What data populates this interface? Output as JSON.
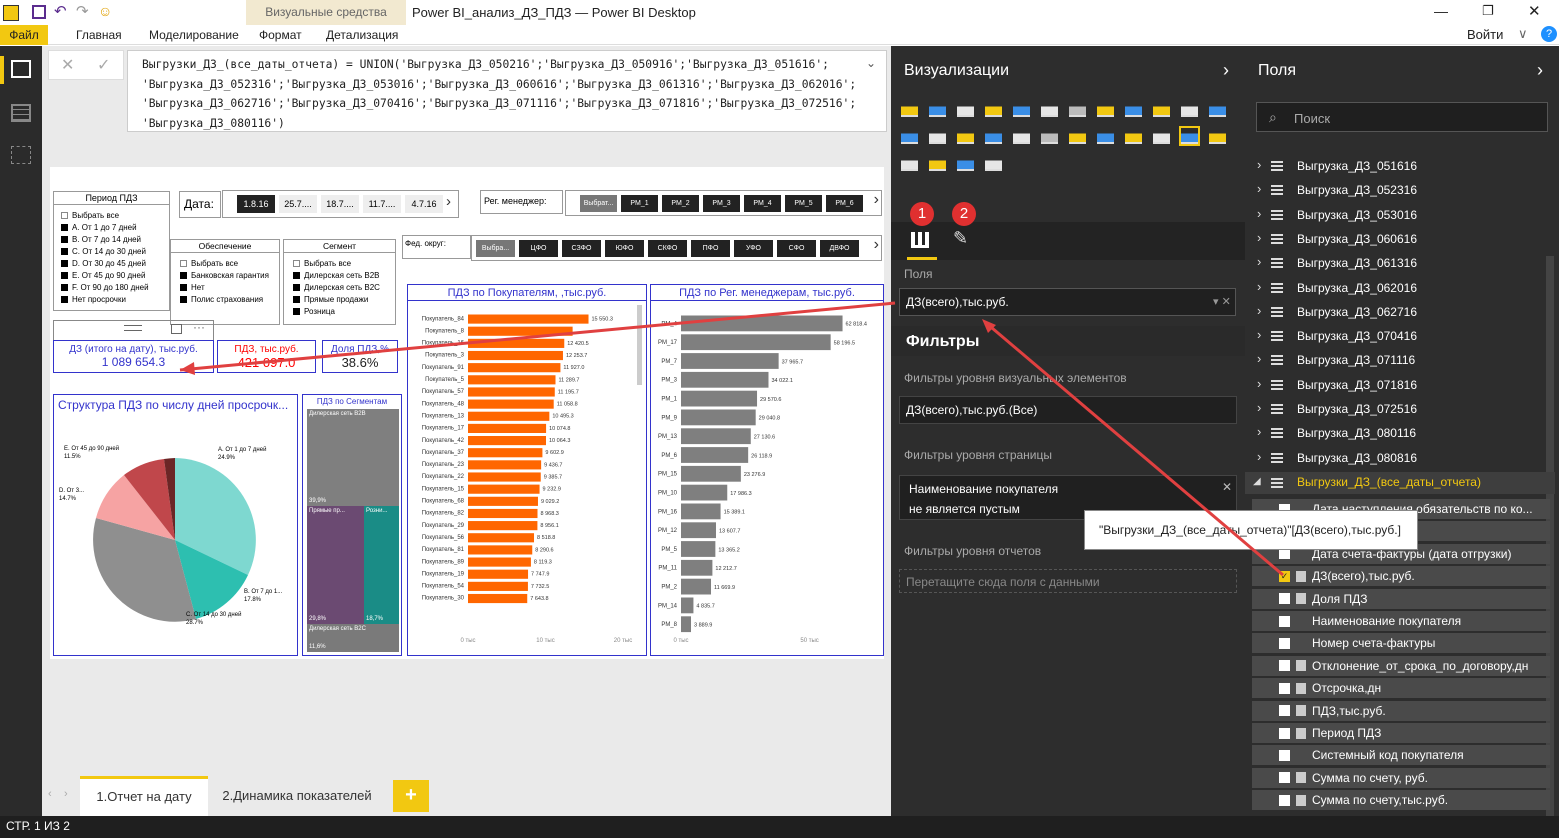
{
  "window": {
    "title": "Power BI_анализ_ДЗ_ПДЗ — Power BI Desktop",
    "context_tab": "Визуальные средства",
    "signin": "Войти",
    "ribbon_tabs": [
      "Файл",
      "Главная",
      "Моделирование",
      "Формат",
      "Детализация"
    ]
  },
  "formula": {
    "text": "Выгрузки_ДЗ_(все_даты_отчета) = UNION('Выгрузка_ДЗ_050216';'Выгрузка_ДЗ_050916';'Выгрузка_ДЗ_051616';\n'Выгрузка_ДЗ_052316';'Выгрузка_ДЗ_053016';'Выгрузка_ДЗ_060616';'Выгрузка_ДЗ_061316';'Выгрузка_ДЗ_062016';\n'Выгрузка_ДЗ_062716';'Выгрузка_ДЗ_070416';'Выгрузка_ДЗ_071116';'Выгрузка_ДЗ_071816';'Выгрузка_ДЗ_072516';\n'Выгрузка_ДЗ_080116')"
  },
  "report": {
    "period_slicer": {
      "title": "Период ПДЗ",
      "items": [
        "Выбрать все",
        "A. От 1 до 7 дней",
        "B. От 7 до 14 дней",
        "C. От 14 до 30 дней",
        "D. От 30 до 45 дней",
        "E. От 45 до 90 дней",
        "F. От 90 до 180 дней",
        "Нет просрочки"
      ]
    },
    "date_slicer": {
      "label": "Дата:",
      "items": [
        "1.8.16",
        "25.7....",
        "18.7....",
        "11.7....",
        "4.7.16"
      ]
    },
    "manager_slicer": {
      "label": "Рег. менеджер:",
      "items": [
        "Выбрат...",
        "PM_1",
        "PM_2",
        "PM_3",
        "PM_4",
        "PM_5",
        "PM_6"
      ]
    },
    "okrug_slicer": {
      "label": "Фед. округ:",
      "items": [
        "Выбра...",
        "ЦФО",
        "СЗФО",
        "ЮФО",
        "СКФО",
        "ПФО",
        "УФО",
        "СФО",
        "ДВФО"
      ]
    },
    "security_slicer": {
      "title": "Обеспечение",
      "items": [
        "Выбрать все",
        "Банковская гарантия",
        "Нет",
        "Полис страхования"
      ]
    },
    "segment_slicer": {
      "title": "Сегмент",
      "items": [
        "Выбрать все",
        "Дилерская сеть B2B",
        "Дилерская сеть B2C",
        "Прямые продажи",
        "Розница"
      ]
    },
    "cards": [
      {
        "label": "ДЗ (итого на дату), тыс.руб.",
        "value": "1 089 654.3"
      },
      {
        "label": "ПДЗ, тыс.руб.",
        "value": "421 097.0"
      },
      {
        "label": "Доля ПДЗ,%",
        "value": "38.6%"
      }
    ],
    "pie_title": "Структура ПДЗ по числу дней просрочк...",
    "pie_labels": [
      {
        "name": "A. От 1 до 7 дней",
        "pct": "24.9%"
      },
      {
        "name": "B. От 7 до 1...",
        "pct": "17.8%"
      },
      {
        "name": "C. От 14 до 30 дней",
        "pct": "28.7%"
      },
      {
        "name": "D. От 3...",
        "pct": "14.7%"
      },
      {
        "name": "E. От 45 до 90 дней",
        "pct": "11.5%"
      }
    ],
    "treemap": {
      "title": "ПДЗ по Сегментам",
      "cells": [
        {
          "name": "Дилерская сеть B2B",
          "pct": "39,9%"
        },
        {
          "name": "Прямые пр...",
          "pct": "29,8%"
        },
        {
          "name": "Розни...",
          "pct": "18,7%"
        },
        {
          "name": "Дилерская сеть B2C",
          "pct": "11,6%"
        }
      ]
    },
    "tabs": [
      "1.Отчет на дату",
      "2.Динамика показателей"
    ],
    "add_tab": "+"
  },
  "chart_data": [
    {
      "type": "bar",
      "title": "ПДЗ по Покупателям, ,тыс.руб.",
      "categories": [
        "Покупатель_84",
        "Покупатель_8",
        "Покупатель_16",
        "Покупатель_3",
        "Покупатель_91",
        "Покупатель_5",
        "Покупатель_57",
        "Покупатель_48",
        "Покупатель_13",
        "Покупатель_17",
        "Покупатель_42",
        "Покупатель_37",
        "Покупатель_23",
        "Покупатель_22",
        "Покупатель_15",
        "Покупатель_68",
        "Покупатель_82",
        "Покупатель_29",
        "Покупатель_56",
        "Покупатель_81",
        "Покупатель_89",
        "Покупатель_19",
        "Покупатель_54",
        "Покупатель_30"
      ],
      "values": [
        15550.3,
        13500,
        12420.5,
        12253.7,
        11927.0,
        11289.7,
        11195.7,
        11058.8,
        10495.3,
        10074.8,
        10064.3,
        9602.9,
        9436.7,
        9385.7,
        9232.9,
        9029.2,
        8968.3,
        8956.1,
        8518.8,
        8290.6,
        8119.3,
        7747.9,
        7732.5,
        7643.8
      ],
      "value_labels": [
        "15 550.3",
        "",
        "12 420.5",
        "12 253.7",
        "11 927.0",
        "11 289.7",
        "11 195.7",
        "11 058.8",
        "10 495.3",
        "10 074.8",
        "10 064.3",
        "9 602.9",
        "9 436.7",
        "9 385.7",
        "9 232.9",
        "9 029.2",
        "8 968.3",
        "8 956.1",
        "8 518.8",
        "8 290.6",
        "8 119.3",
        "7 747.9",
        "7 732.5",
        "7 643.8"
      ],
      "x_ticks": [
        "0 тыс",
        "10 тыс",
        "20 тыс"
      ],
      "xlim": [
        0,
        20000
      ],
      "color": "#ff6600"
    },
    {
      "type": "bar",
      "title": "ПДЗ по Рег. менеджерам, тыс.руб.",
      "categories": [
        "PM_4",
        "PM_17",
        "PM_7",
        "PM_3",
        "PM_1",
        "PM_9",
        "PM_13",
        "PM_6",
        "PM_15",
        "PM_10",
        "PM_16",
        "PM_12",
        "PM_5",
        "PM_11",
        "PM_2",
        "PM_14",
        "PM_8"
      ],
      "values": [
        62818.4,
        58196.5,
        37965.7,
        34022.1,
        29570.6,
        29040.8,
        27130.6,
        26118.9,
        23276.9,
        17986.3,
        15389.1,
        13607.7,
        13365.2,
        12212.7,
        11669.9,
        4835.7,
        3889.9
      ],
      "value_labels": [
        "62 818.4",
        "58 196.5",
        "37 965.7",
        "34 022.1",
        "29 570.6",
        "29 040.8",
        "27 130.6",
        "26 118.9",
        "23 276.9",
        "17 986.3",
        "15 389.1",
        "13 607.7",
        "13 365.2",
        "12 212.7",
        "11 669.9",
        "4 835.7",
        "3 889.9"
      ],
      "x_ticks": [
        "0 тыс",
        "50 тыс"
      ],
      "xlim": [
        0,
        70000
      ],
      "color": "#7f7f7f"
    }
  ],
  "viz_pane": {
    "title": "Визуализации",
    "badge1": "1",
    "badge2": "2",
    "fields_label": "Поля",
    "field_value": "ДЗ(всего),тыс.руб.",
    "filters_title": "Фильтры",
    "visual_filters_label": "Фильтры уровня визуальных элементов",
    "visual_filter_value": "ДЗ(всего),тыс.руб.(Все)",
    "page_filters_label": "Фильтры уровня страницы",
    "page_filter_line1": "Наименование покупателя",
    "page_filter_line2": "не является пустым",
    "report_filters_label": "Фильтры уровня отчетов",
    "report_filters_drop": "Перетащите сюда поля с данными"
  },
  "field_pane": {
    "title": "Поля",
    "search_placeholder": "Поиск",
    "tables": [
      "Выгрузка_ДЗ_051616",
      "Выгрузка_ДЗ_052316",
      "Выгрузка_ДЗ_053016",
      "Выгрузка_ДЗ_060616",
      "Выгрузка_ДЗ_061316",
      "Выгрузка_ДЗ_062016",
      "Выгрузка_ДЗ_062716",
      "Выгрузка_ДЗ_070416",
      "Выгрузка_ДЗ_071116",
      "Выгрузка_ДЗ_071816",
      "Выгрузка_ДЗ_072516",
      "Выгрузка_ДЗ_080116",
      "Выгрузка_ДЗ_080816"
    ],
    "expanded_table": "Выгрузки_ДЗ_(все_даты_отчета)",
    "fields": [
      "Дата наступления обязательств по ко...",
      "",
      "Дата счета-фактуры (дата отгрузки)",
      "ДЗ(всего),тыс.руб.",
      "Доля ПДЗ",
      "Наименование покупателя",
      "Номер счета-фактуры",
      "Отклонение_от_срока_по_договору,дн",
      "Отсрочка,дн",
      "ПДЗ,тыс.руб.",
      "Период ПДЗ",
      "Системный код покупателя",
      "Сумма по счету, руб.",
      "Сумма по счету,тыс.руб."
    ],
    "tooltip": "\"Выгрузки_ДЗ_(все_даты_отчета)\"[ДЗ(всего),тыс.руб.]"
  },
  "status": "СТР. 1 ИЗ 2",
  "colors": {
    "accent": "#f2c811",
    "orange": "#ff6600",
    "blue": "#3333cc",
    "red": "#ff0000",
    "dark": "#2d2d2d"
  }
}
